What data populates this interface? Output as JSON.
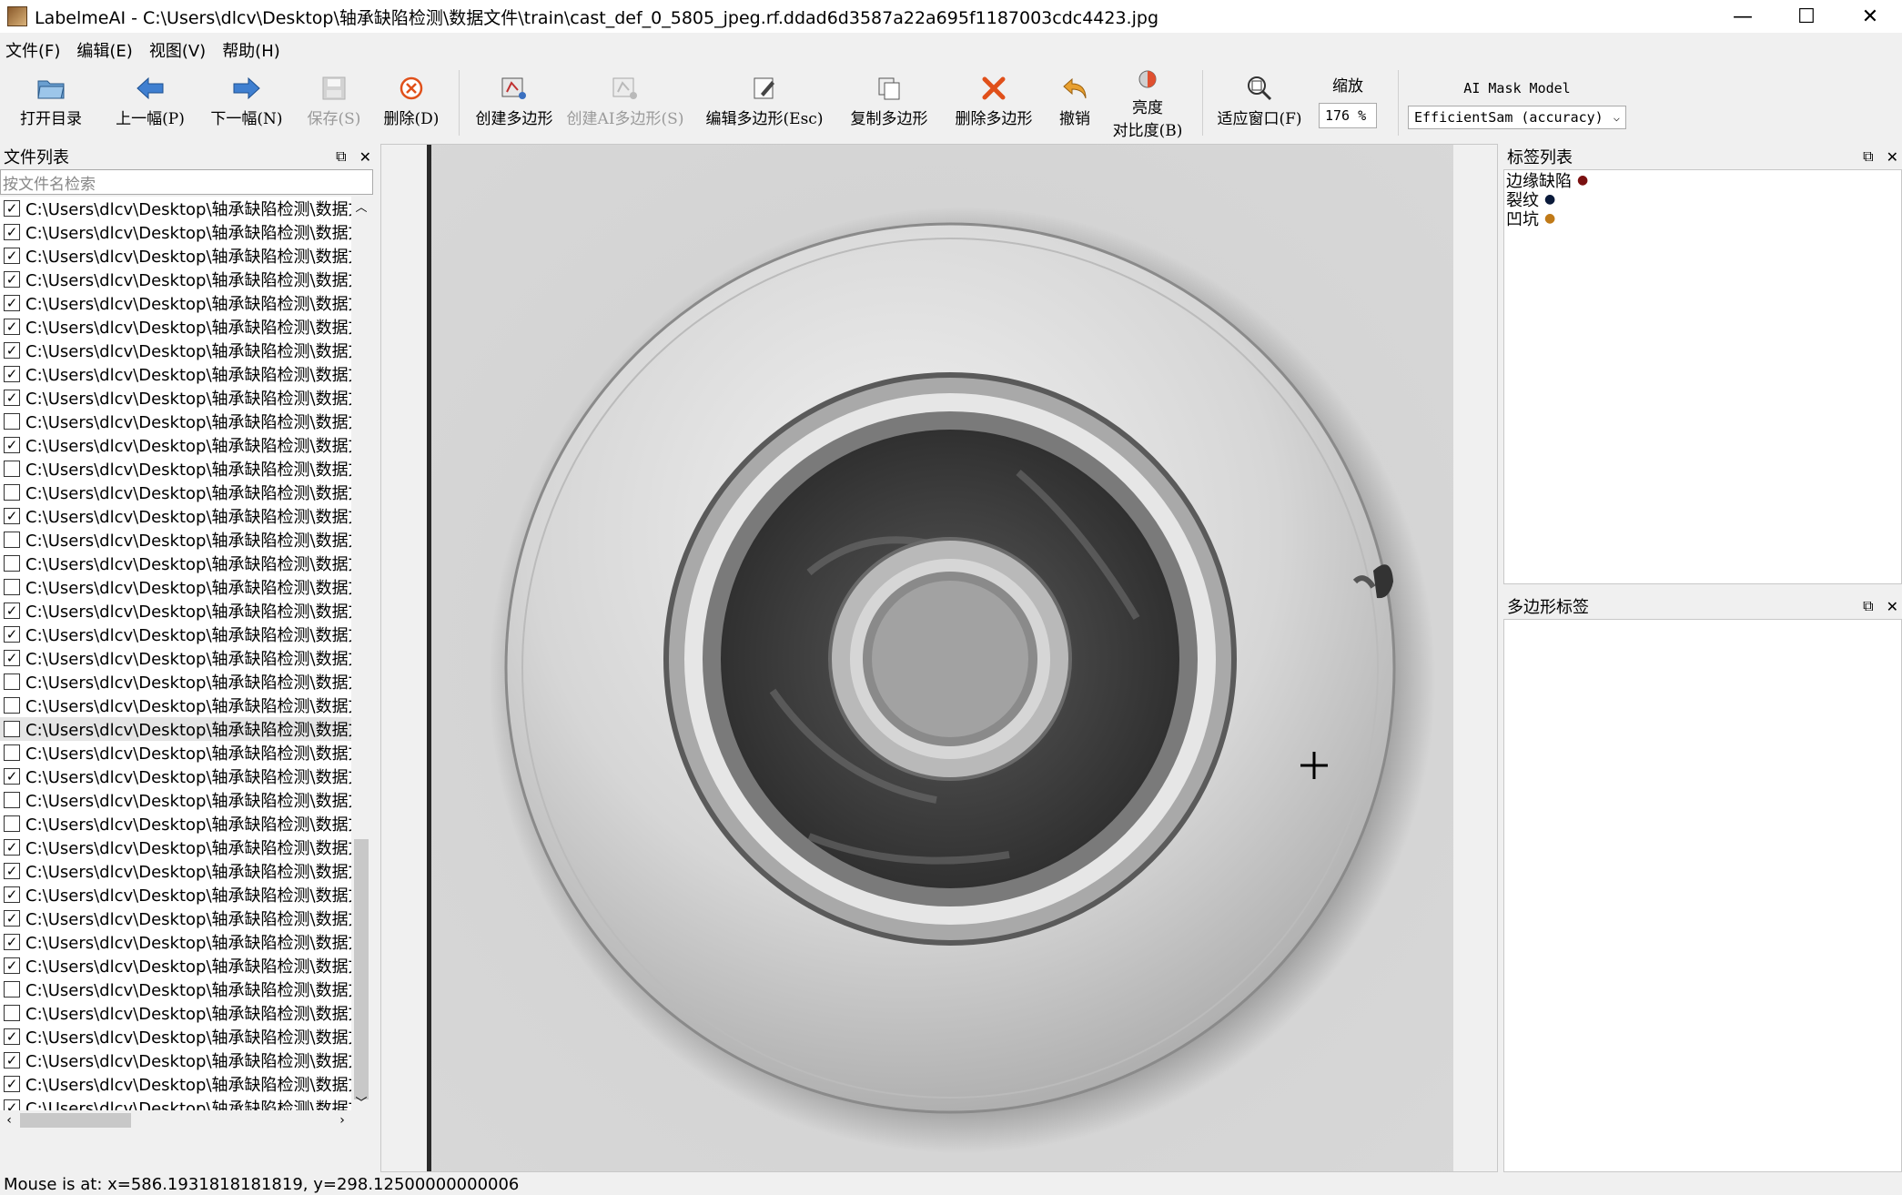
{
  "window": {
    "title": "LabelmeAI - C:\\Users\\dlcv\\Desktop\\轴承缺陷检测\\数据文件\\train\\cast_def_0_5805_jpeg.rf.ddad6d3587a22a695f1187003cdc4423.jpg",
    "minimize": "—",
    "maximize": "☐",
    "close": "✕"
  },
  "menu": [
    "文件(F)",
    "编辑(E)",
    "视图(V)",
    "帮助(H)"
  ],
  "toolbar": {
    "open_dir": "打开目录",
    "prev": "上一幅(P)",
    "next": "下一幅(N)",
    "save": "保存(S)",
    "delete": "删除(D)",
    "create_polygon": "创建多边形",
    "create_ai_polygon": "创建AI多边形(S)",
    "edit_polygon": "编辑多边形(Esc)",
    "copy_polygon": "复制多边形",
    "delete_polygon": "删除多边形",
    "undo": "撤销",
    "brightness_line1": "亮度",
    "brightness_line2": "对比度(B)",
    "fit_window": "适应窗口(F)",
    "zoom_label": "缩放",
    "zoom_value": "176 %",
    "ai_model_label": "AI Mask Model",
    "ai_model_value": "EfficientSam (accuracy)"
  },
  "file_panel": {
    "title": "文件列表",
    "search_placeholder": "按文件名检索",
    "row_text": "C:\\Users\\dlcv\\Desktop\\轴承缺陷检测\\数据文",
    "checked": [
      true,
      true,
      true,
      true,
      true,
      true,
      true,
      true,
      true,
      false,
      true,
      false,
      false,
      true,
      false,
      false,
      false,
      true,
      true,
      true,
      false,
      false,
      false,
      false,
      true,
      false,
      false,
      true,
      true,
      true,
      true,
      true,
      true,
      false,
      false,
      true,
      true,
      true,
      true,
      true
    ],
    "selected_index": 22
  },
  "label_panel": {
    "title": "标签列表",
    "labels": [
      {
        "name": "边缘缺陷",
        "color": "#7a1010"
      },
      {
        "name": "裂纹",
        "color": "#0a1a3a"
      },
      {
        "name": "凹坑",
        "color": "#c07a18"
      }
    ]
  },
  "poly_panel": {
    "title": "多边形标签"
  },
  "status": {
    "text": "Mouse is at: x=586.1931818181819, y=298.12500000000006"
  }
}
